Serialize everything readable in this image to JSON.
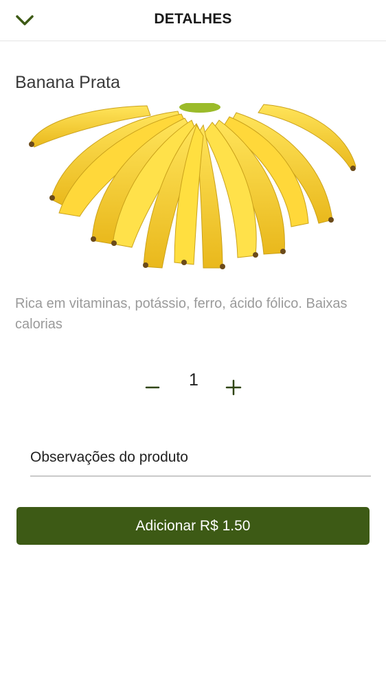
{
  "header": {
    "title": "DETALHES",
    "back_icon": "chevron-down-icon"
  },
  "product": {
    "name": "Banana Prata",
    "description": "Rica em vitaminas, potássio, ferro, ácido fólico. Baixas calorias",
    "image_icon": "banana-bunch-image"
  },
  "quantity": {
    "value": "1",
    "minus_symbol": "–",
    "plus_symbol": "+"
  },
  "notes": {
    "placeholder": "Observações do produto",
    "value": ""
  },
  "add_button": {
    "label": "Adicionar R$ 1.50"
  },
  "colors": {
    "accent": "#3d5a15",
    "banana": "#f5cf2b"
  }
}
